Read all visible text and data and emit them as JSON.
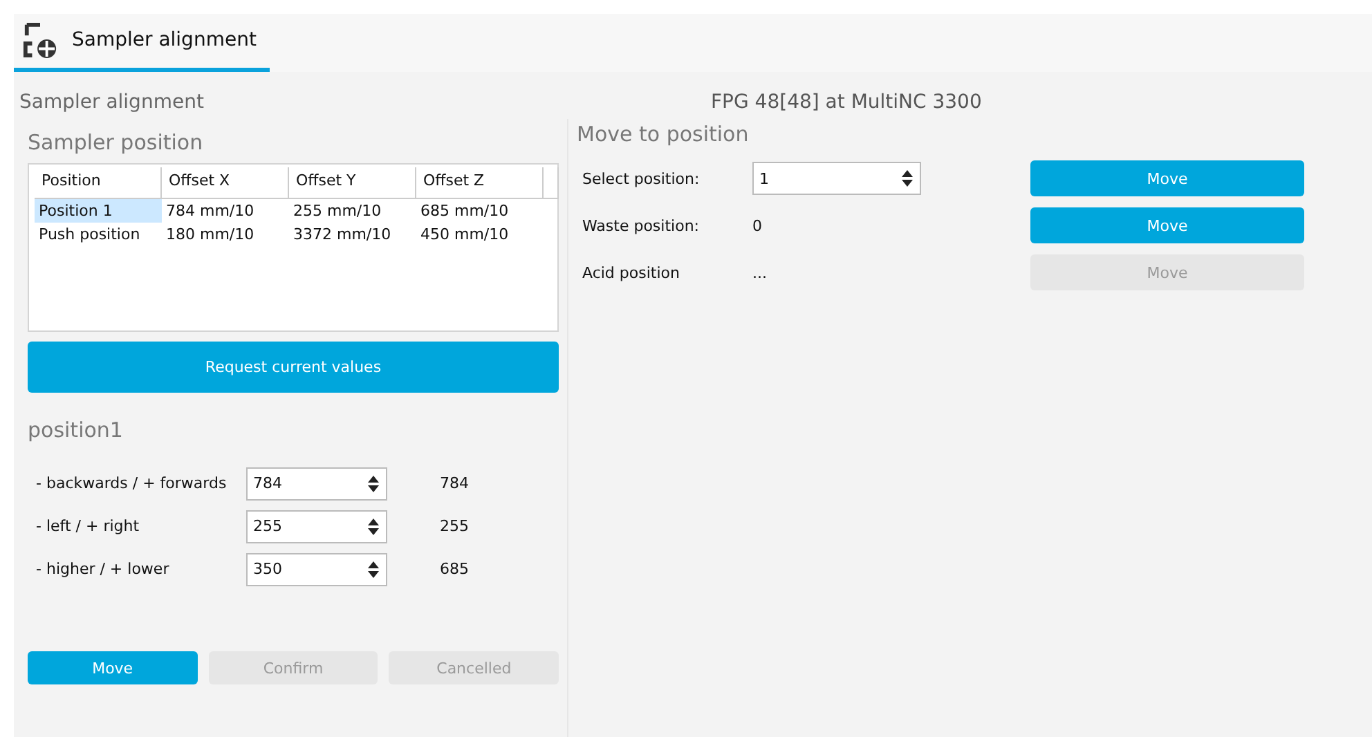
{
  "tabs": [
    {
      "label": "Sampler alignment",
      "selected": true
    }
  ],
  "page_title": "Sampler alignment",
  "instrument": "FPG 48[48] at MultiNC 3300",
  "sampler_position": {
    "title": "Sampler position",
    "columns": [
      "Position",
      "Offset X",
      "Offset Y",
      "Offset Z"
    ],
    "rows": [
      {
        "cells": [
          "Position 1",
          "784 mm/10",
          "255 mm/10",
          "685 mm/10"
        ],
        "selected": true
      },
      {
        "cells": [
          "Push position",
          "180 mm/10",
          "3372 mm/10",
          "450 mm/10"
        ],
        "selected": false
      }
    ],
    "request_button": {
      "label": "Request current values",
      "disabled": false
    }
  },
  "position_editor": {
    "title": "position1",
    "axes": [
      {
        "label": "- backwards / + forwards",
        "value": "784",
        "current": "784"
      },
      {
        "label": "- left / + right",
        "value": "255",
        "current": "255"
      },
      {
        "label": "- higher / + lower",
        "value": "350",
        "current": "685"
      }
    ],
    "buttons": [
      {
        "label": "Move",
        "disabled": false
      },
      {
        "label": "Confirm",
        "disabled": true
      },
      {
        "label": "Cancelled",
        "disabled": true
      }
    ]
  },
  "move_to_position": {
    "title": "Move to position",
    "rows": [
      {
        "kind": "spin",
        "label": "Select position:",
        "value": "1",
        "button": {
          "label": "Move",
          "disabled": false
        }
      },
      {
        "kind": "text",
        "label": "Waste position:",
        "value": "0",
        "button": {
          "label": "Move",
          "disabled": false
        }
      },
      {
        "kind": "text",
        "label": "Acid position",
        "value": "...",
        "button": {
          "label": "Move",
          "disabled": true
        }
      }
    ]
  }
}
